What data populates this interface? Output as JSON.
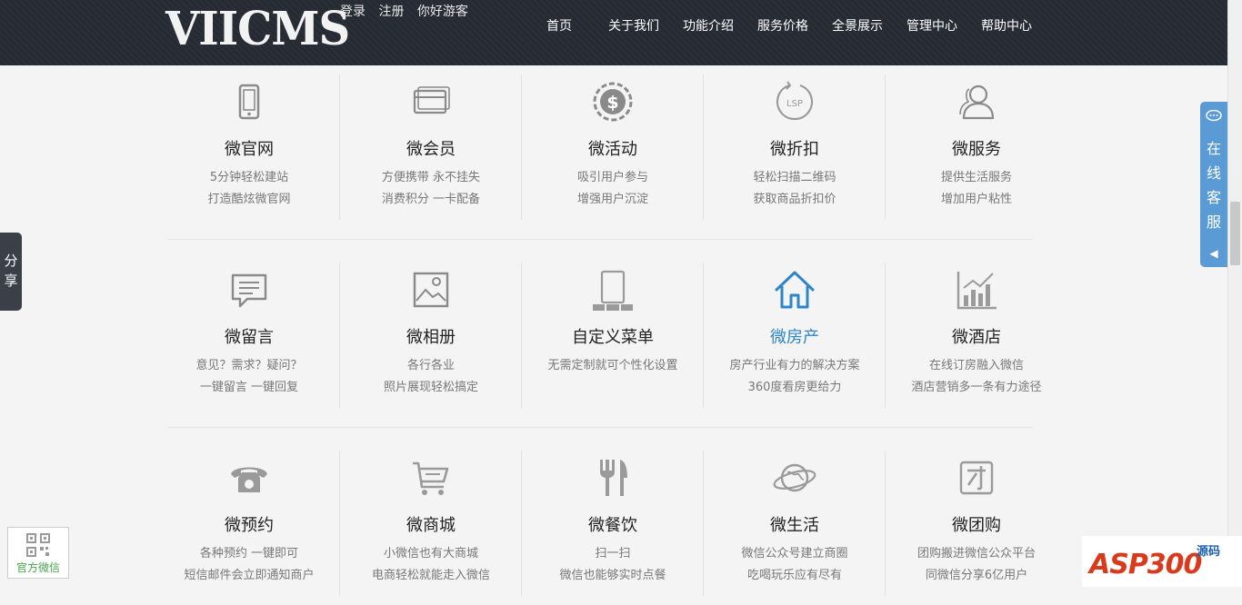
{
  "header": {
    "logo": "VIICMS",
    "auth": {
      "login": "登录",
      "register": "注册",
      "guest": "你好游客"
    },
    "nav": [
      "首页",
      "关于我们",
      "功能介绍",
      "服务价格",
      "全景展示",
      "管理中心",
      "帮助中心"
    ]
  },
  "features": [
    [
      {
        "icon": "phone-icon",
        "title": "微官网",
        "lines": [
          "5分钟轻松建站",
          "打造酷炫微官网"
        ]
      },
      {
        "icon": "member-card-icon",
        "title": "微会员",
        "lines": [
          "方便携带 永不挂失",
          "消费积分 一卡配备"
        ]
      },
      {
        "icon": "dollar-coin-icon",
        "title": "微活动",
        "lines": [
          "吸引用户参与",
          "增强用户沉淀"
        ]
      },
      {
        "icon": "discount-icon",
        "title": "微折扣",
        "lines": [
          "轻松扫描二维码",
          "获取商品折扣价"
        ]
      },
      {
        "icon": "user-icon",
        "title": "微服务",
        "lines": [
          "提供生活服务",
          "增加用户粘性"
        ]
      }
    ],
    [
      {
        "icon": "message-icon",
        "title": "微留言",
        "lines": [
          "意见？需求？疑问？",
          "一键留言 一键回复"
        ]
      },
      {
        "icon": "photo-icon",
        "title": "微相册",
        "lines": [
          "各行各业",
          "照片展现轻松搞定"
        ]
      },
      {
        "icon": "menu-device-icon",
        "title": "自定义菜单",
        "lines": [
          "无需定制就可个性化设置",
          ""
        ]
      },
      {
        "icon": "house-icon",
        "title": "微房产",
        "lines": [
          "房产行业有力的解决方案",
          "360度看房更给力"
        ]
      },
      {
        "icon": "chart-icon",
        "title": "微酒店",
        "lines": [
          "在线订房融入微信",
          "酒店营销多一条有力途径"
        ]
      }
    ],
    [
      {
        "icon": "telephone-icon",
        "title": "微预约",
        "lines": [
          "各种预约 一键即可",
          "短信邮件会立即通知商户"
        ]
      },
      {
        "icon": "cart-icon",
        "title": "微商城",
        "lines": [
          "小微信也有大商城",
          "电商轻松就能走入微信"
        ]
      },
      {
        "icon": "fork-knife-icon",
        "title": "微餐饮",
        "lines": [
          "扫一扫",
          "微信也能够实时点餐"
        ]
      },
      {
        "icon": "planet-icon",
        "title": "微生活",
        "lines": [
          "微信公众号建立商圈",
          "吃喝玩乐应有尽有"
        ]
      },
      {
        "icon": "group-buy-icon",
        "title": "微团购",
        "lines": [
          "团购搬进微信公众平台",
          "同微信分享6亿用户"
        ]
      }
    ]
  ],
  "side": {
    "share": "分享",
    "service": "在线客服",
    "service_arrow": "◀",
    "wechat": "官方微信"
  },
  "brand": {
    "main": "ASP300",
    "sub": "源码"
  },
  "colors": {
    "header": "#262a33",
    "highlight": "#2e86c8",
    "service": "#5b9bd5",
    "wechat": "#47a34a"
  }
}
